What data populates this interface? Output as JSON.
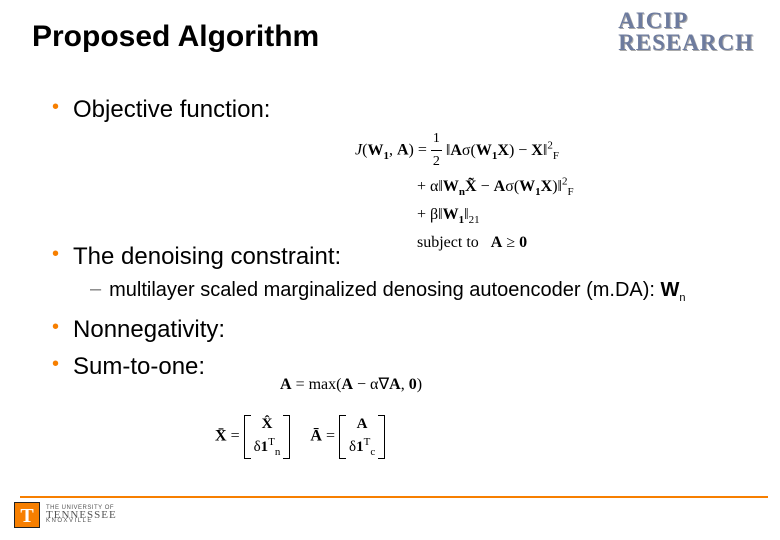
{
  "header": {
    "title": "Proposed Algorithm",
    "logo_line1": "AICIP",
    "logo_line2": "RESEARCH"
  },
  "bullets": {
    "b1": "Objective function:",
    "b2": "The denoising constraint:",
    "b2_sub": "multilayer scaled marginalized denosing autoencoder (m.DA): ",
    "b2_sub_var": "W",
    "b2_sub_varsub": "n",
    "b3": "Nonnegativity:",
    "b4": "Sum-to-one:"
  },
  "equations": {
    "objective": {
      "line1_left": "J(W₁, A) = ",
      "frac_num": "1",
      "frac_den": "2",
      "line1_right": "‖Aσ(W₁X) − X‖",
      "line1_sup": "2",
      "line1_sub": "F",
      "line2": "+ α‖WₙX̃ − Aσ(W₁X)‖",
      "line2_sup": "2",
      "line2_sub": "F",
      "line3": "+ β‖W₁‖",
      "line3_sub": "21",
      "line4": "subject to A ≥ 0"
    },
    "nonneg": "A = max(A − α∇A, 0)",
    "sumtoone": {
      "lhs1": "X̄ = ",
      "m1r1": "X̂",
      "m1r2": "δ1ₙᵀ",
      "lhs2": "  Ā = ",
      "m2r1": "A",
      "m2r2": "δ1꜀ᵀ"
    }
  },
  "footer": {
    "badge": "T",
    "line1": "THE UNIVERSITY OF",
    "line2": "TENNESSEE",
    "line3": "KNOXVILLE"
  }
}
